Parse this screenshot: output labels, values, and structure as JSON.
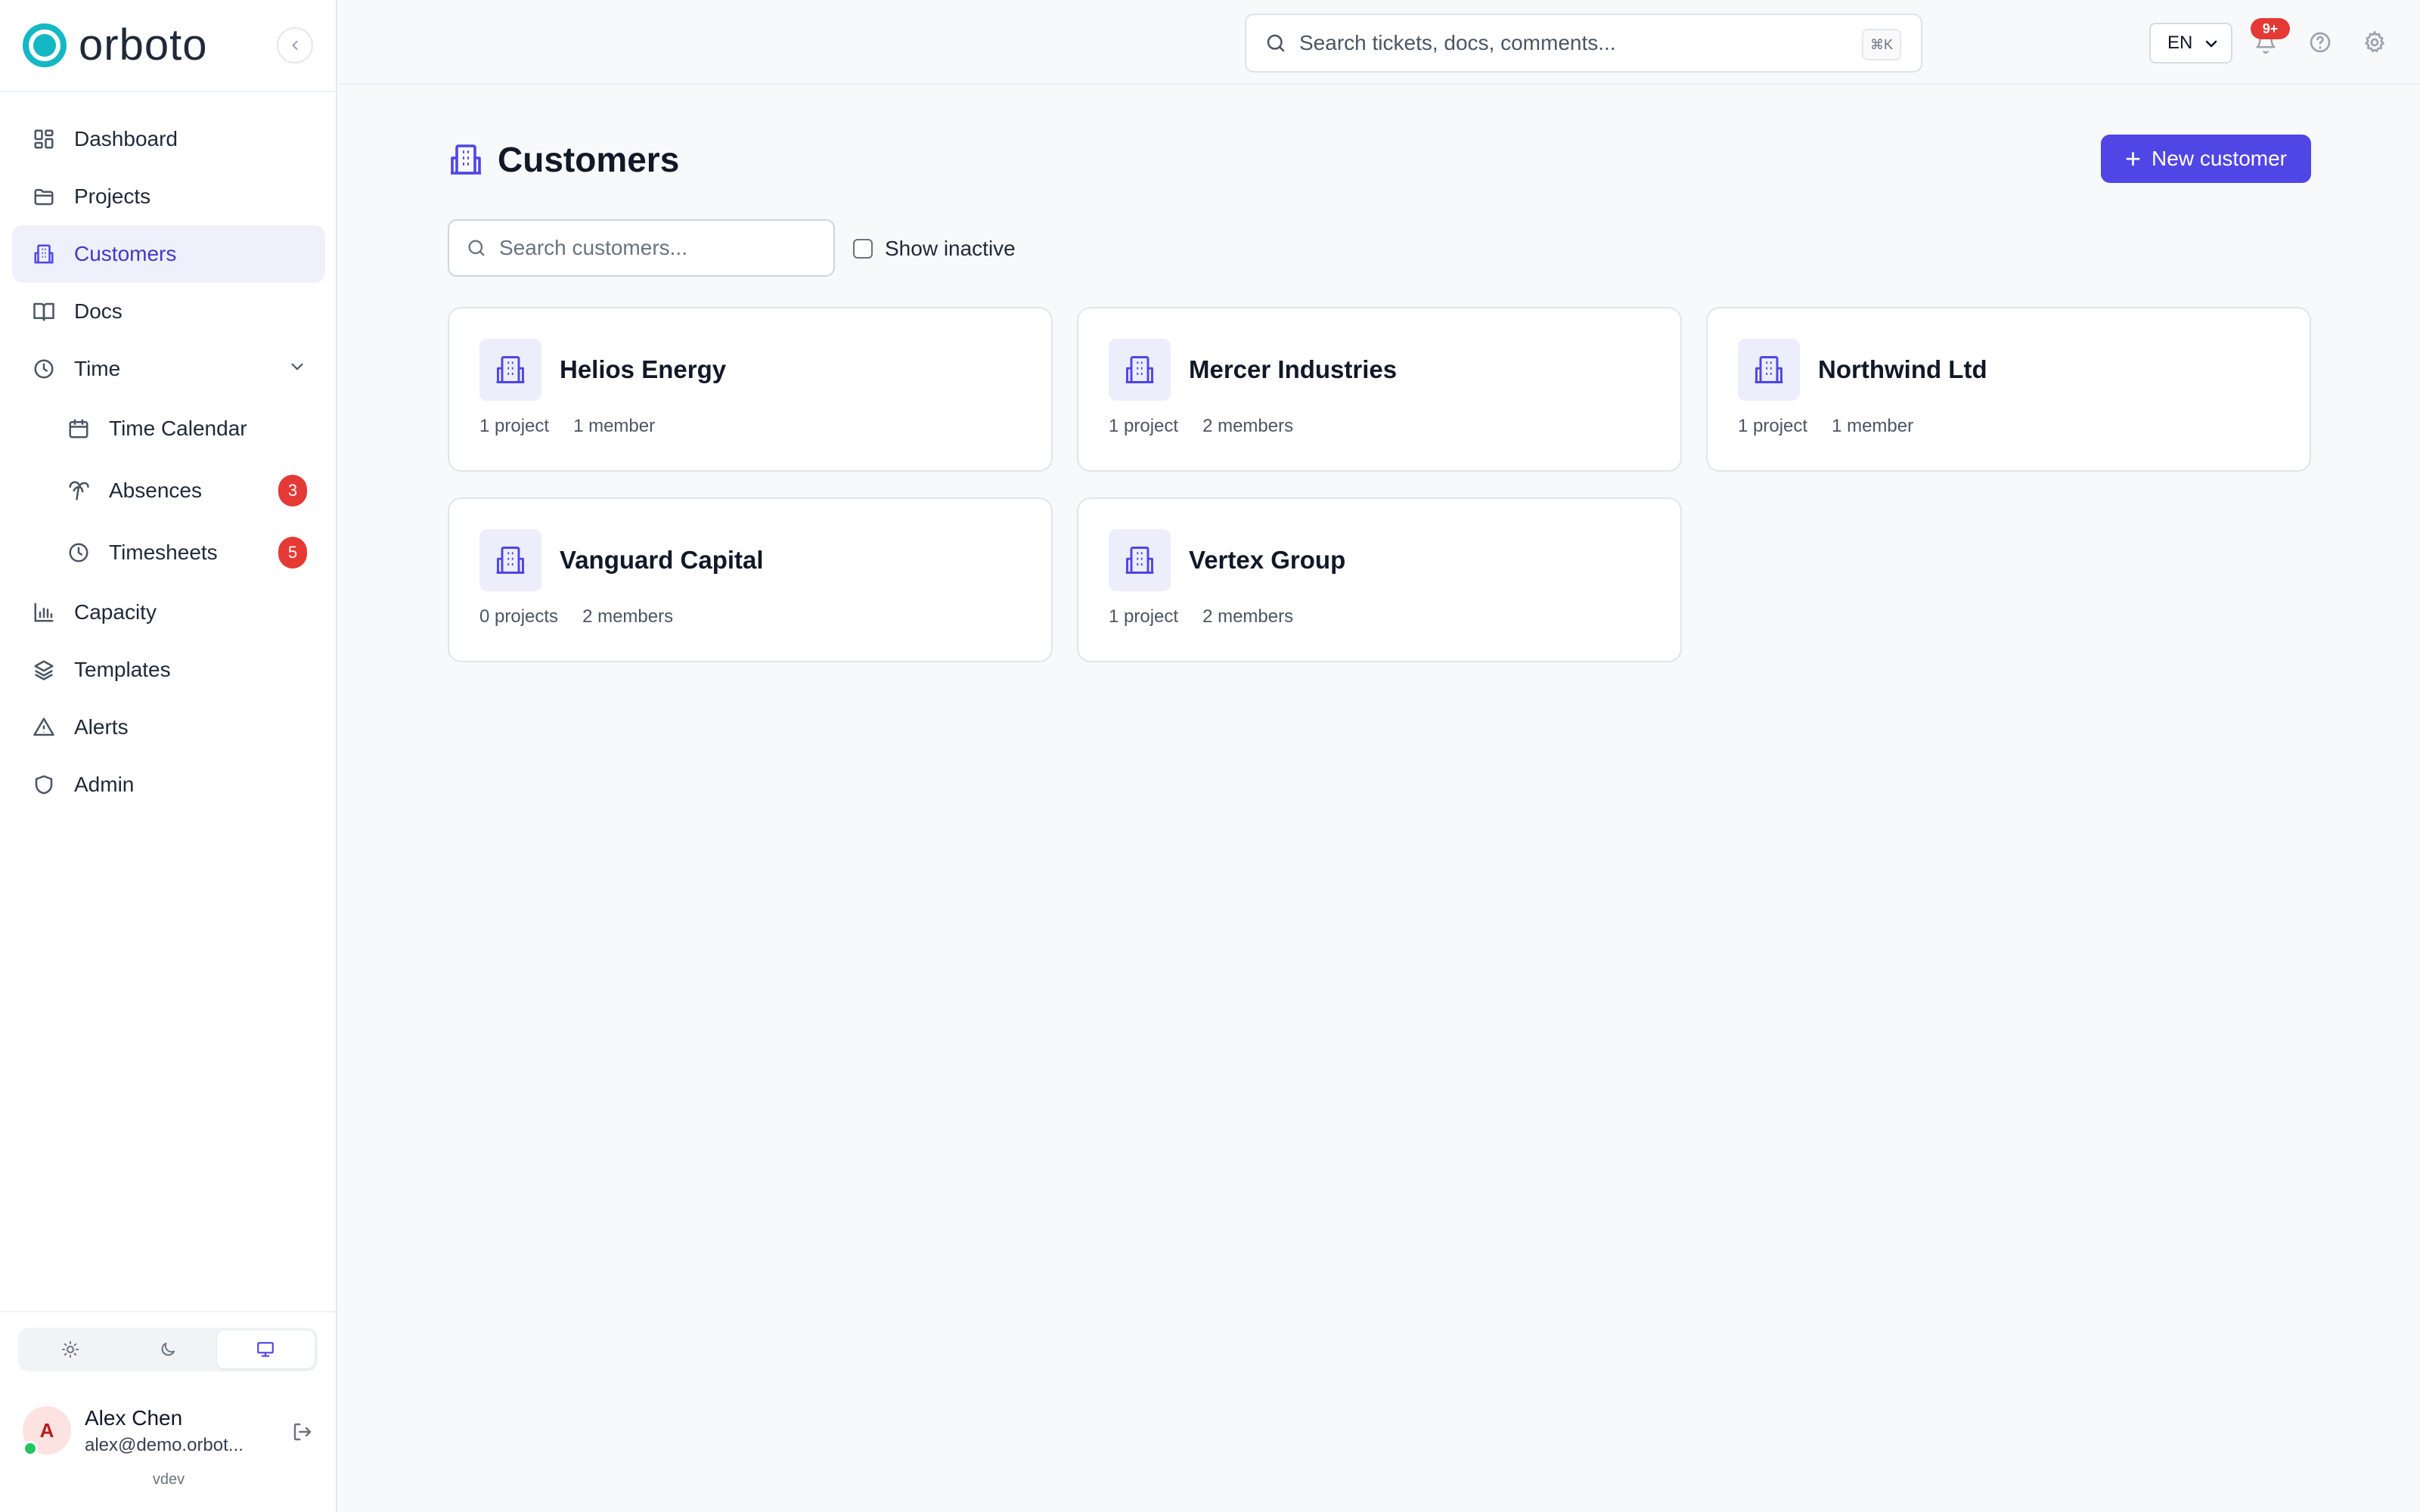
{
  "brand": {
    "name": "orboto"
  },
  "colors": {
    "accent": "#4f46e5",
    "brand": "#14b8c4",
    "badge": "#e53935",
    "online": "#22c55e"
  },
  "sidebar": {
    "items": [
      {
        "label": "Dashboard",
        "icon": "grid-icon"
      },
      {
        "label": "Projects",
        "icon": "folder-icon"
      },
      {
        "label": "Customers",
        "icon": "building-icon",
        "active": true
      },
      {
        "label": "Docs",
        "icon": "book-icon"
      },
      {
        "label": "Time",
        "icon": "clock-icon",
        "expanded": true
      },
      {
        "label": "Time Calendar",
        "icon": "calendar-icon"
      },
      {
        "label": "Absences",
        "icon": "palm-tree-icon",
        "badge": "3"
      },
      {
        "label": "Timesheets",
        "icon": "clock-icon",
        "badge": "5"
      },
      {
        "label": "Capacity",
        "icon": "bar-chart-icon"
      },
      {
        "label": "Templates",
        "icon": "layers-icon"
      },
      {
        "label": "Alerts",
        "icon": "warning-icon"
      },
      {
        "label": "Admin",
        "icon": "shield-icon"
      }
    ],
    "theme_options": [
      "light",
      "dark",
      "system"
    ],
    "theme_selected": "system",
    "user": {
      "initial": "A",
      "name": "Alex Chen",
      "email": "alex@demo.orbot..."
    },
    "version": "vdev"
  },
  "topbar": {
    "search_placeholder": "Search tickets, docs, comments...",
    "shortcut": "⌘K",
    "language": "EN",
    "notification_count": "9+"
  },
  "page": {
    "title": "Customers",
    "new_button": "New customer",
    "search_placeholder": "Search customers...",
    "show_inactive_label": "Show inactive",
    "show_inactive_checked": false
  },
  "customers": [
    {
      "name": "Helios Energy",
      "projects": "1 project",
      "members": "1 member"
    },
    {
      "name": "Mercer Industries",
      "projects": "1 project",
      "members": "2 members"
    },
    {
      "name": "Northwind Ltd",
      "projects": "1 project",
      "members": "1 member"
    },
    {
      "name": "Vanguard Capital",
      "projects": "0 projects",
      "members": "2 members"
    },
    {
      "name": "Vertex Group",
      "projects": "1 project",
      "members": "2 members"
    }
  ]
}
